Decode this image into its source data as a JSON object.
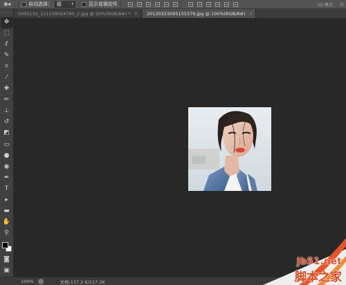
{
  "options_bar": {
    "tool_icon": "move-icon",
    "auto_select_label": "自动选择：",
    "auto_select_value": "组",
    "transform_controls_label": "显示变换控件",
    "mode_3d_label": "3D 模式："
  },
  "tabs": [
    {
      "label": "5005132_111539054740_2.jpg @ 50%(RGB/8#) *",
      "close": "×"
    },
    {
      "label": "20130323095155379.jpg @ 100%(RGB/8#)",
      "close": "×"
    }
  ],
  "tools": [
    {
      "name": "move-tool",
      "glyph": "✥",
      "icon": "move-icon"
    },
    {
      "name": "marquee-tool",
      "glyph": "⬚",
      "icon": "rect-marquee-icon"
    },
    {
      "name": "lasso-tool",
      "glyph": "ℓ",
      "icon": "lasso-icon"
    },
    {
      "name": "quick-select-tool",
      "glyph": "✎",
      "icon": "quick-select-icon"
    },
    {
      "name": "crop-tool",
      "glyph": "⌗",
      "icon": "crop-icon"
    },
    {
      "name": "eyedropper-tool",
      "glyph": "⁄",
      "icon": "eyedropper-icon"
    },
    {
      "name": "healing-tool",
      "glyph": "✚",
      "icon": "healing-brush-icon"
    },
    {
      "name": "brush-tool",
      "glyph": "✏",
      "icon": "brush-icon"
    },
    {
      "name": "stamp-tool",
      "glyph": "⊥",
      "icon": "clone-stamp-icon"
    },
    {
      "name": "history-brush-tool",
      "glyph": "↺",
      "icon": "history-brush-icon"
    },
    {
      "name": "eraser-tool",
      "glyph": "◩",
      "icon": "eraser-icon"
    },
    {
      "name": "gradient-tool",
      "glyph": "▭",
      "icon": "gradient-icon"
    },
    {
      "name": "blur-tool",
      "glyph": "●",
      "icon": "blur-drop-icon"
    },
    {
      "name": "dodge-tool",
      "glyph": "◉",
      "icon": "dodge-icon"
    },
    {
      "name": "pen-tool",
      "glyph": "✒",
      "icon": "pen-icon"
    },
    {
      "name": "type-tool",
      "glyph": "T",
      "icon": "type-icon"
    },
    {
      "name": "path-select-tool",
      "glyph": "▸",
      "icon": "path-select-icon"
    },
    {
      "name": "shape-tool",
      "glyph": "▬",
      "icon": "rectangle-shape-icon"
    },
    {
      "name": "hand-tool",
      "glyph": "✋",
      "icon": "hand-icon"
    },
    {
      "name": "zoom-tool",
      "glyph": "⚲",
      "icon": "zoom-icon"
    }
  ],
  "status": {
    "zoom": "100%",
    "document": "文档:117.2 K/117.2K"
  },
  "watermark": {
    "site": "jb51.net",
    "name": "脚本之家"
  },
  "colors": {
    "background": "#282828",
    "panel": "#404040",
    "watermark": "#e0502a"
  }
}
